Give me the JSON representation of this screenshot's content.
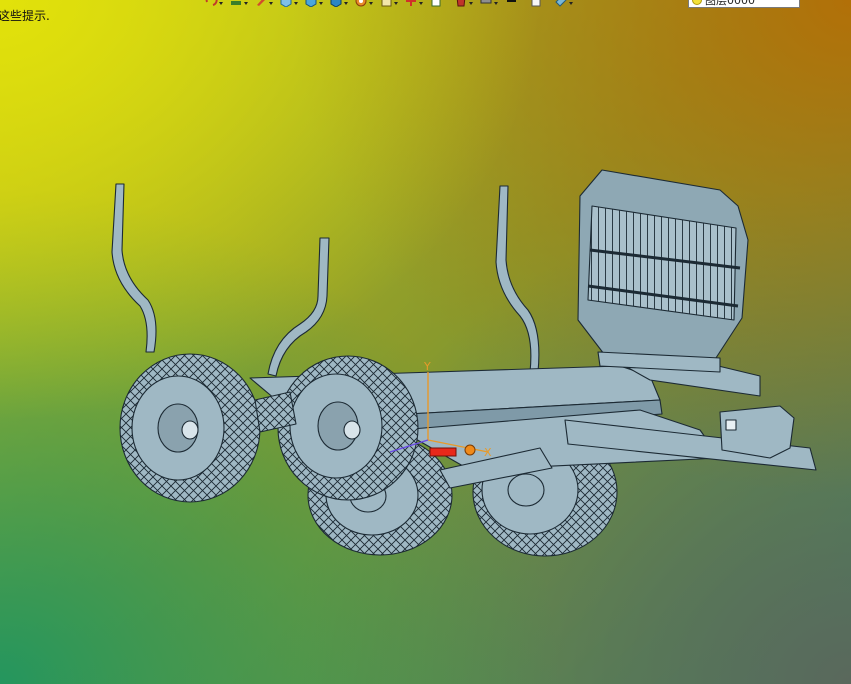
{
  "hint_text": "这些提示.",
  "layer_combo": {
    "value": "图层0000",
    "icon": "lightbulb-icon"
  },
  "toolbar_icons": [
    "redo-icon",
    "layers-icon",
    "pencil-icon",
    "box-view-icon",
    "cube-icon",
    "cube-shaded-icon",
    "wheel-icon",
    "clipboard-icon",
    "snap-icon",
    "document-icon",
    "paint-bucket-icon",
    "printer-icon",
    "black-square-icon",
    "white-page-icon",
    "eraser-icon"
  ],
  "triad": {
    "y_label": "Y",
    "x_label": "X"
  },
  "colors": {
    "model_fill": "#9fb8c4",
    "model_stroke": "#1c2a34",
    "bg_yellow": "#e2e20a",
    "bg_green": "#24965e"
  }
}
